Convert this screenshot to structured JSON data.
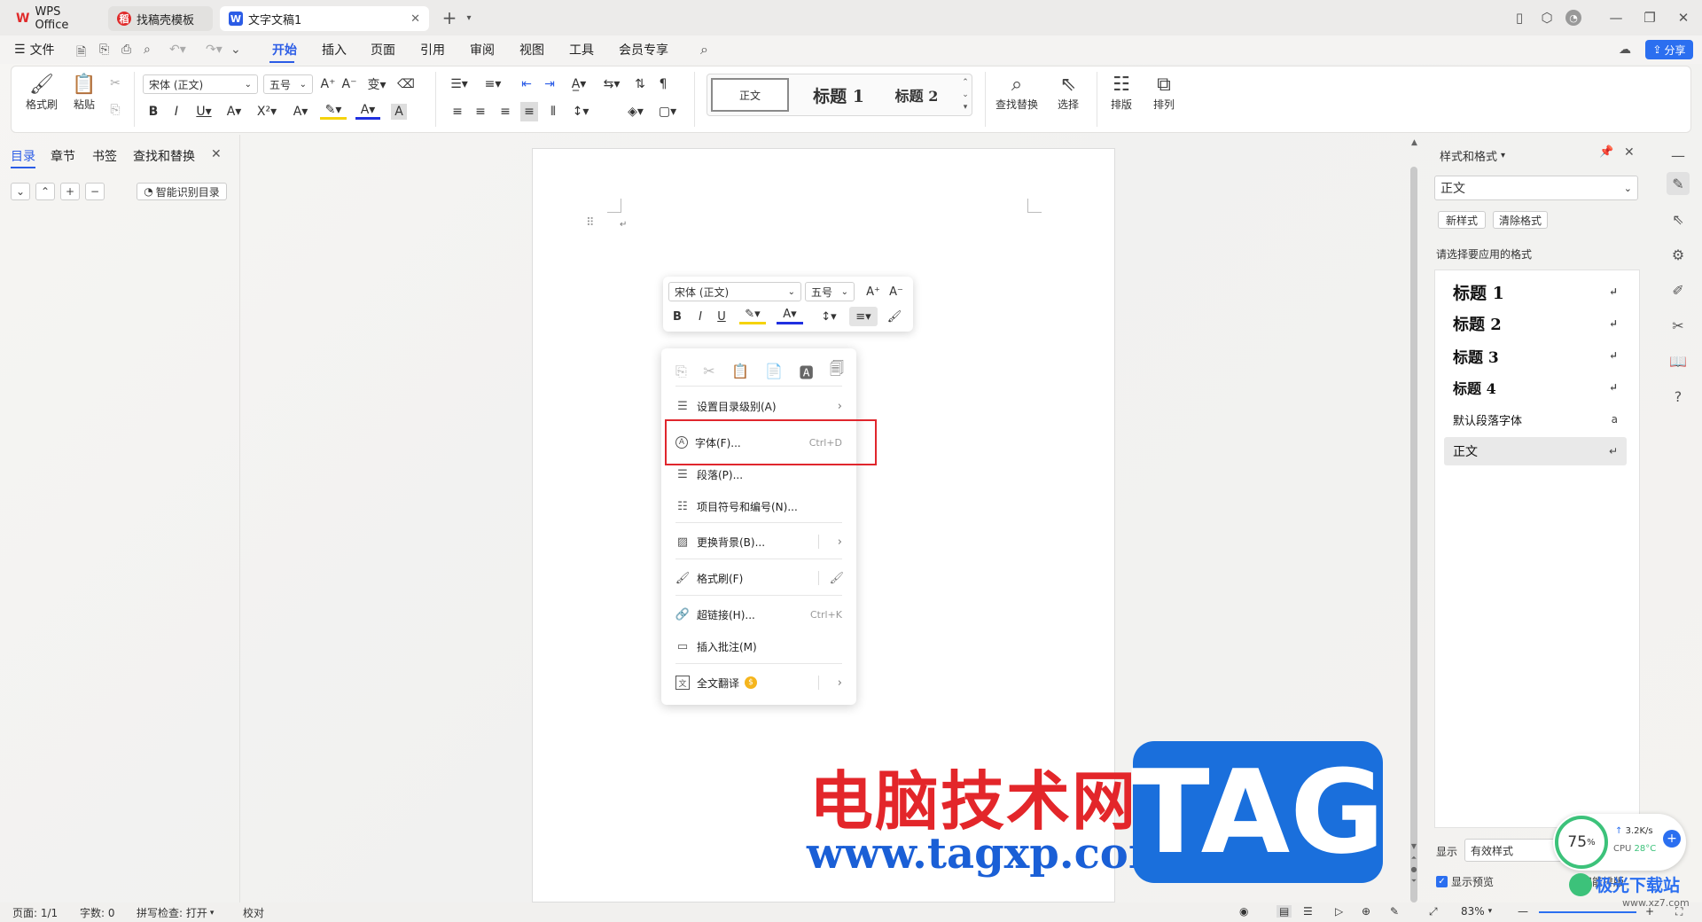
{
  "titlebar": {
    "tabs": [
      {
        "label": "WPS Office",
        "icon": "wps-logo-icon"
      },
      {
        "label": "找稿壳模板",
        "icon": "template-icon"
      },
      {
        "label": "文字文稿1",
        "icon": "writer-doc-icon"
      }
    ],
    "new_tab": "+",
    "brand_color": "#e02b2b",
    "writer_color": "#2b5ce6"
  },
  "menu": {
    "file": "文件",
    "tabs": [
      "开始",
      "插入",
      "页面",
      "引用",
      "审阅",
      "视图",
      "工具",
      "会员专享"
    ],
    "active_tab": "开始",
    "share": "分享"
  },
  "ribbon": {
    "format_painter": "格式刷",
    "paste": "粘贴",
    "font_name": "宋体 (正文)",
    "font_size": "五号",
    "styles": [
      "正文",
      "标题 1",
      "标题 2"
    ],
    "find_replace": "查找替换",
    "select": "选择",
    "layout": "排版",
    "arrange": "排列"
  },
  "left_nav": {
    "tabs": [
      "目录",
      "章节",
      "书签",
      "查找和替换"
    ],
    "active_tab": "目录",
    "smart_toc": "智能识别目录"
  },
  "mini_toolbar": {
    "font_name": "宋体 (正文)",
    "font_size": "五号"
  },
  "context_menu": {
    "items": [
      {
        "label": "设置目录级别(A)",
        "shortcut": "",
        "submenu": true
      },
      {
        "label": "字体(F)...",
        "shortcut": "Ctrl+D",
        "submenu": false
      },
      {
        "label": "段落(P)...",
        "shortcut": "",
        "submenu": false
      },
      {
        "label": "项目符号和编号(N)...",
        "shortcut": "",
        "submenu": false
      },
      {
        "label": "更换背景(B)...",
        "shortcut": "",
        "submenu": true
      },
      {
        "label": "格式刷(F)",
        "shortcut": "",
        "submenu": false
      },
      {
        "label": "超链接(H)...",
        "shortcut": "Ctrl+K",
        "submenu": false
      },
      {
        "label": "插入批注(M)",
        "shortcut": "",
        "submenu": false
      },
      {
        "label": "全文翻译",
        "shortcut": "",
        "submenu": true
      }
    ],
    "highlight_color": "#e0262d"
  },
  "right_panel": {
    "title": "样式和格式",
    "current_style": "正文",
    "new_style": "新样式",
    "clear_format": "清除格式",
    "apply_hint": "请选择要应用的格式",
    "styles": [
      "标题 1",
      "标题 2",
      "标题 3",
      "标题 4",
      "默认段落字体",
      "正文"
    ],
    "show_label": "显示",
    "show_value": "有效样式",
    "preview_label": "显示预览",
    "smart_layout": "智能排版"
  },
  "monitor": {
    "percent": "75",
    "percent_sign": "%",
    "speed": "3.2K/s",
    "cpu": "CPU",
    "temp": "28°C"
  },
  "status": {
    "page": "页面: 1/1",
    "words": "字数: 0",
    "spell": "拼写检查: 打开",
    "proof": "校对",
    "zoom": "83%"
  },
  "watermark": {
    "cn": "电脑技术网",
    "url": "www.tagxp.com",
    "tag": "TAG",
    "site": "极光下载站",
    "site_url": "www.xz7.com"
  }
}
